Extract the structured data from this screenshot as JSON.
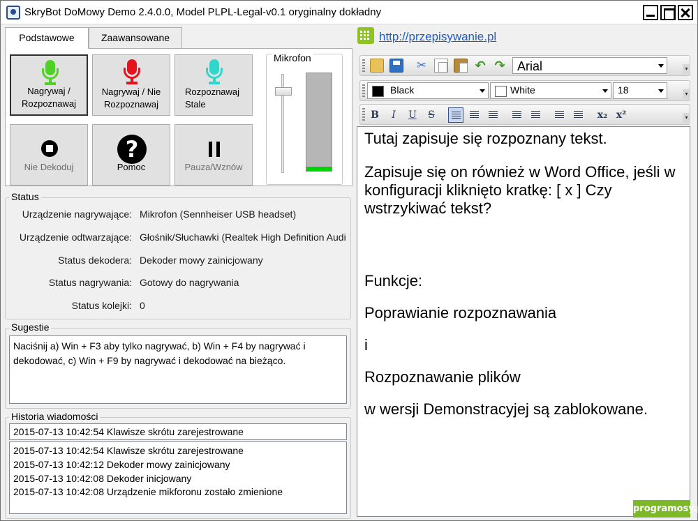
{
  "window": {
    "title": "SkryBot DoMowy Demo 2.4.0.0, Model PLPL-Legal-v0.1 oryginalny dokładny"
  },
  "tabs": [
    {
      "label": "Podstawowe",
      "active": true
    },
    {
      "label": "Zaawansowane",
      "active": false
    }
  ],
  "buttons": {
    "record_recognize": "Nagrywaj / Rozpoznawaj",
    "record_no_recognize": "Nagrywaj / Nie Rozpoznawaj",
    "recognize_continuous": "Rozpoznawaj Stale",
    "no_decode": "Nie Dekoduj",
    "help": "Pomoc",
    "pause_resume": "Pauza/Wznów"
  },
  "microphone": {
    "title": "Mikrofon",
    "slider_level": 0.85,
    "input_level": 0.04
  },
  "status": {
    "title": "Status",
    "rows": [
      {
        "label": "Urządzenie nagrywające:",
        "value": "Mikrofon (Sennheiser USB headset)"
      },
      {
        "label": "Urządzenie odtwarzające:",
        "value": "Głośnik/Słuchawki (Realtek High Definition Audio)"
      },
      {
        "label": "Status dekodera:",
        "value": "Dekoder mowy zainicjowany"
      },
      {
        "label": "Status nagrywania:",
        "value": "Gotowy do nagrywania"
      },
      {
        "label": "Status kolejki:",
        "value": "0"
      }
    ]
  },
  "suggestions": {
    "title": "Sugestie",
    "text": "Naciśnij a) Win + F3 aby tylko nagrywać, b) Win + F4 by nagrywać i dekodować, c) Win + F9 by nagrywać i dekodować na bieżąco."
  },
  "history": {
    "title": "Historia wiadomości",
    "latest": "2015-07-13 10:42:54 Klawisze skrótu zarejestrowane",
    "items": [
      "2015-07-13 10:42:54 Klawisze skrótu zarejestrowane",
      "2015-07-13 10:42:12 Dekoder mowy zainicjowany",
      "2015-07-13 10:42:08 Dekoder inicjowany",
      "2015-07-13 10:42:08 Urządzenie mikforonu zostało zmienione"
    ]
  },
  "link": {
    "url_text": "http://przepisywanie.pl"
  },
  "toolbar": {
    "font": "Arial",
    "fore_color": {
      "name": "Black",
      "hex": "#000000"
    },
    "back_color": {
      "name": "White",
      "hex": "#ffffff"
    },
    "font_size": "18",
    "bold": "B",
    "italic": "I",
    "underline": "U",
    "strike": "S",
    "subscript": "x₂",
    "superscript": "x²"
  },
  "editor": {
    "paragraphs": [
      "Tutaj zapisuje się rozpoznany tekst.",
      "Zapisuje się on również w Word Office, jeśli w konfiguracji kliknięto kratkę: [ x ] Czy wstrzykiwać tekst?",
      "",
      "Funkcje:",
      "Poprawianie rozpoznawania",
      "i",
      "Rozpoznawanie plików",
      "w wersji Demonstracyjej są zablokowane."
    ]
  },
  "watermark": "programosy.pl"
}
